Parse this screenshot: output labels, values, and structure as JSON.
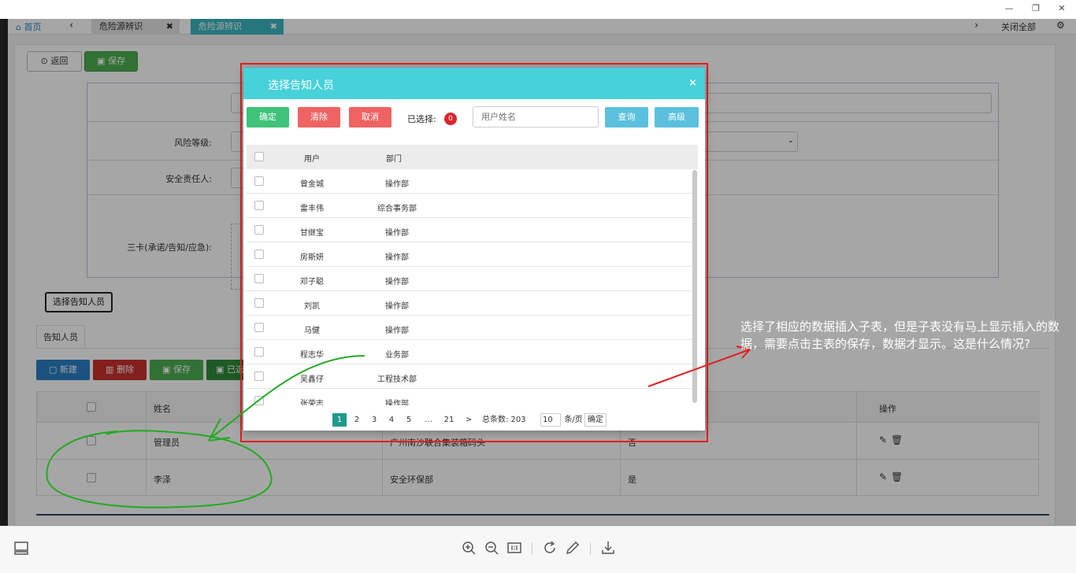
{
  "window": {
    "controls": [
      "—",
      "❐",
      "✕"
    ]
  },
  "tabs": {
    "home": "首页",
    "back": "‹",
    "items": [
      {
        "label": "危险源辨识",
        "close": "✖"
      },
      {
        "label": "危险源辨识",
        "close": "✖"
      }
    ],
    "next": "›",
    "close_all": "关闭全部"
  },
  "toolbar": {
    "back_label": "返回",
    "save_label": "保存"
  },
  "form": {
    "risk_level_label": "风险等级:",
    "safety_owner_label": "安全责任人:",
    "three_cards_label": "三卡(承诺/告知/应急):"
  },
  "pick_button_label": "选择告知人员",
  "subtab_label": "告知人员",
  "sub_toolbar": {
    "new": "新建",
    "delete": "删除",
    "save": "保存",
    "extra": "已选"
  },
  "grid": {
    "headers": {
      "name": "姓名",
      "action": "操作"
    },
    "rows": [
      {
        "name": "管理员",
        "dept": "广州南沙联合集装箱码头",
        "flag": "否"
      },
      {
        "name": "李泽",
        "dept": "安全环保部",
        "flag": "是"
      }
    ]
  },
  "modal": {
    "title": "选择告知人员",
    "close": "×",
    "buttons": {
      "confirm": "确定",
      "clear": "清除",
      "cancel": "取消",
      "query": "查询",
      "advanced": "高级"
    },
    "selected_label": "已选择:",
    "selected_count": "0",
    "search_placeholder": "用户姓名",
    "headers": {
      "user": "用户",
      "dept": "部门"
    },
    "rows": [
      {
        "user": "曾金城",
        "dept": "操作部"
      },
      {
        "user": "雷丰伟",
        "dept": "综合事务部"
      },
      {
        "user": "甘继宝",
        "dept": "操作部"
      },
      {
        "user": "房斯妍",
        "dept": "操作部"
      },
      {
        "user": "邓子聪",
        "dept": "操作部"
      },
      {
        "user": "刘凯",
        "dept": "操作部"
      },
      {
        "user": "马健",
        "dept": "操作部"
      },
      {
        "user": "程志华",
        "dept": "业务部"
      },
      {
        "user": "吴鑫仔",
        "dept": "工程技术部"
      },
      {
        "user": "张荣志",
        "dept": "操作部"
      }
    ],
    "pager": {
      "pages": [
        "1",
        "2",
        "3",
        "4",
        "5",
        "...",
        "21",
        ">"
      ],
      "total_label": "总条数: 203",
      "page_size": "10",
      "per_page_label": "条/页",
      "go": "确定"
    }
  },
  "annotation": "选择了相应的数据插入子表，但是子表没有马上显示插入的数据，需要点击主表的保存，数据才显示。这是什么情况?",
  "colors": {
    "modal_header": "#47d1d9",
    "highlight": "#e02020",
    "arrow_green": "#22aa22"
  }
}
